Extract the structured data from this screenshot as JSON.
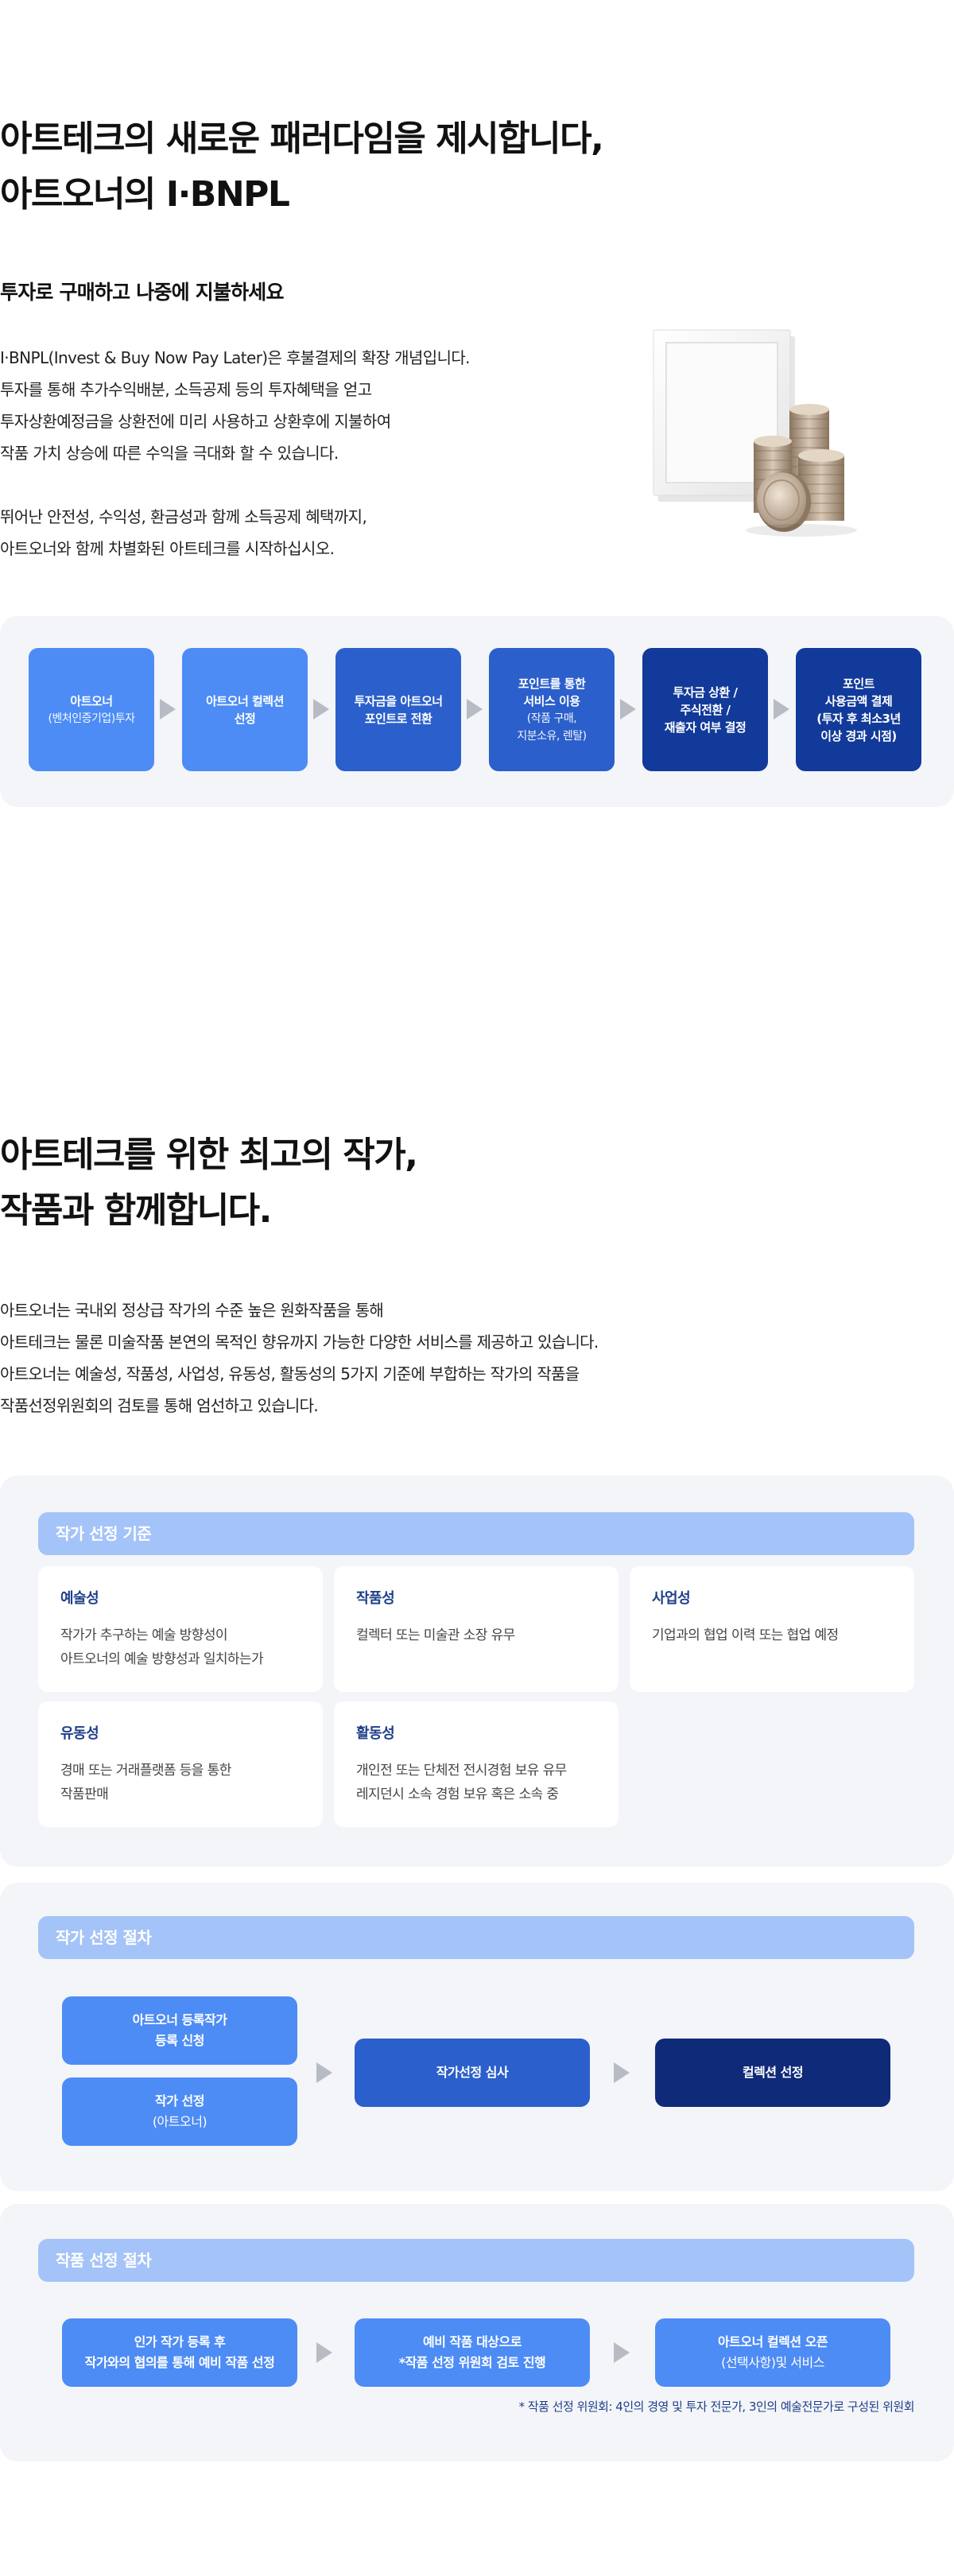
{
  "intro": {
    "title_lines": [
      "아트테크의 새로운 패러다임을 제시합니다,",
      "아트오너의 I·BNPL"
    ],
    "subtitle": "투자로 구매하고 나중에 지불하세요",
    "description_lines": [
      "I·BNPL(Invest & Buy Now Pay Later)은 후불결제의 확장 개념입니다.",
      "투자를 통해 추가수익배분, 소득공제 등의 투자혜택을 얻고",
      "투자상환예정금을 상환전에 미리 사용하고 상환후에 지불하여",
      "작품 가치 상승에 따른 수익을 극대화 할 수 있습니다.",
      "",
      "뛰어난 안전성, 수익성, 환금성과 함께 소득공제 혜택까지,",
      "아트오너와 함께 차별화된 아트테크를 시작하십시오."
    ]
  },
  "flow": {
    "steps": [
      {
        "line1": "아트오너",
        "line2": "(벤처인증기업)투자",
        "line3": "",
        "line4": "",
        "color": "#4d8cf5"
      },
      {
        "line1": "아트오너 컬렉션",
        "line2": "선정",
        "line3": "",
        "line4": "",
        "color": "#4d8cf5"
      },
      {
        "line1": "투자금을 아트오너",
        "line2": "포인트로 전환",
        "line3": "",
        "line4": "",
        "color": "#2b5fcb"
      },
      {
        "line1": "포인트를 통한",
        "line2": "서비스 이용",
        "line3": "(작품 구매,",
        "line4": "지분소유, 렌탈)",
        "color": "#2b5fcb"
      },
      {
        "line1": "투자금 상환 /",
        "line2": "주식전환 /",
        "line3": "재출자 여부 결정",
        "line4": "",
        "color": "#123a9a"
      },
      {
        "line1": "포인트",
        "line2": "사용금액 결제",
        "line3": "(투자 후 최소3년",
        "line4": "이상 경과 시점)",
        "color": "#123a9a"
      }
    ]
  },
  "artists": {
    "title_lines": [
      "아트테크를 위한 최고의 작가,",
      "작품과 함께합니다."
    ],
    "description_lines": [
      "아트오너는 국내외 정상급 작가의 수준 높은 원화작품을 통해",
      "아트테크는 물론 미술작품 본연의 목적인 향유까지 가능한 다양한 서비스를 제공하고 있습니다.",
      "아트오너는 예술성, 작품성, 사업성, 유동성, 활동성의 5가지 기준에 부합하는 작가의 작품을",
      "작품선정위원회의 검토를 통해 엄선하고 있습니다."
    ]
  },
  "criteria": {
    "heading": "작가 선정 기준",
    "cards": [
      {
        "title": "예술성",
        "lines": [
          "작가가 추구하는 예술 방향성이",
          "아트오너의 예술 방향성과 일치하는가"
        ]
      },
      {
        "title": "작품성",
        "lines": [
          "컬렉터 또는 미술관 소장 유무"
        ]
      },
      {
        "title": "사업성",
        "lines": [
          "기업과의 협업 이력 또는 협업 예정"
        ]
      },
      {
        "title": "유동성",
        "lines": [
          "경매 또는 거래플랫폼 등을 통한",
          "작품판매"
        ]
      },
      {
        "title": "활동성",
        "lines": [
          "개인전 또는 단체전 전시경험 보유 유무",
          "레지던시 소속 경험 보유 혹은 소속 중"
        ]
      }
    ]
  },
  "artist_process": {
    "heading": "작가 선정 절차",
    "box_register": {
      "line1": "아트오너 등록작가",
      "line2": "등록 신청"
    },
    "box_select": {
      "line1": "작가 선정",
      "line2": "(아트오너)"
    },
    "box_review": {
      "line1": "작가선정 심사"
    },
    "box_collection": {
      "line1": "컬렉션 선정"
    }
  },
  "artwork_process": {
    "heading": "작품 선정 절차",
    "box1": {
      "line1": "인가 작가 등록 후",
      "line2": "작가와의 협의를 통해 예비 작품 선정"
    },
    "box2": {
      "line1": "예비 작품 대상으로",
      "line2": "*작품 선정 위원회 검토 진행"
    },
    "box3": {
      "line1": "아트오너 컬렉션 오픈",
      "line2": "(선택사항)및 서비스"
    },
    "note": "* 작품 선정 위원회: 4인의 경영 및 투자 전문가, 3인의 예술전문가로 구성된 위원회"
  },
  "colors": {
    "light_blue": "#4d8cf5",
    "mid_blue": "#2b5fcb",
    "dark_blue": "#123a9a",
    "navy": "#0e2a78",
    "header_blue": "#a4c3f8",
    "panel_gray": "#f3f5f8"
  }
}
